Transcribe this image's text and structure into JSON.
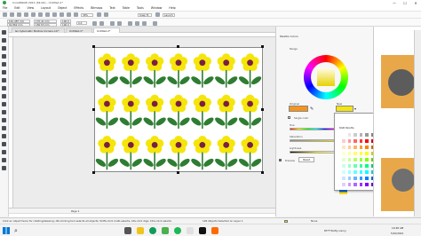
{
  "window": {
    "title": "CorelDRAW 2021 (64-bit) - Untitled-1*",
    "min": "—",
    "max": "☐",
    "close": "✕"
  },
  "menu": [
    "File",
    "Edit",
    "View",
    "Layout",
    "Object",
    "Effects",
    "Bitmaps",
    "Text",
    "Table",
    "Tools",
    "Window",
    "Help"
  ],
  "toolbar": {
    "zoom": "39%",
    "snap_to": "Snap To",
    "launch": "Launch",
    "x_value": "161.487 mm",
    "y_value": "91.862 mm",
    "w_value": "170.41 mm",
    "h_value": "156.53 mm",
    "scale_w": "100.0",
    "scale_h": "100.0",
    "angle": "0.0"
  },
  "tabs": [
    {
      "label": "Go Cybernetic Studios Corners.cdr*"
    },
    {
      "label": "Untitled-1*"
    },
    {
      "label": "Untitled-2*"
    }
  ],
  "page_nav": {
    "label": "Page 1"
  },
  "docker": {
    "title": "Palette Colors",
    "range_label": "Range",
    "original_label": "Original",
    "new_label": "New",
    "single_color_label": "Single color",
    "hue_label": "Hue",
    "saturation_label": "Saturation",
    "lightness_label": "Lightness",
    "preview_label": "Preview",
    "reset_label": "Reset",
    "original_color": "#f7941d",
    "new_color": "#f5e50a"
  },
  "palette_popup": {
    "title": "RGB Palette",
    "colors": [
      "#ffffff",
      "#e6e6e6",
      "#cccccc",
      "#b3b3b3",
      "#999999",
      "#808080",
      "#666666",
      "#4d4d4d",
      "#000000",
      "#ffcccc",
      "#ff9999",
      "#ff6666",
      "#ff3333",
      "#ff0000",
      "#cc0000",
      "#990000",
      "#660000",
      "#330000",
      "#ffe5cc",
      "#ffcc99",
      "#ffb266",
      "#ff9933",
      "#ff8000",
      "#cc6600",
      "#994c00",
      "#663300",
      "#331a00",
      "#ffffcc",
      "#ffff99",
      "#ffff66",
      "#ffff33",
      "#ffff00",
      "#cccc00",
      "#999900",
      "#666600",
      "#333300",
      "#e5ffcc",
      "#ccff99",
      "#b2ff66",
      "#99ff33",
      "#80ff00",
      "#66cc00",
      "#4c9900",
      "#336600",
      "#1a3300",
      "#ccffe5",
      "#99ffcc",
      "#66ffb2",
      "#33ff99",
      "#00ff80",
      "#00cc66",
      "#00994c",
      "#006633",
      "#00331a",
      "#ccffff",
      "#99ffff",
      "#66ffff",
      "#33ffff",
      "#00ffff",
      "#00cccc",
      "#009999",
      "#006666",
      "#003333",
      "#cce5ff",
      "#99ccff",
      "#66b2ff",
      "#3399ff",
      "#0080ff",
      "#0066cc",
      "#004c99",
      "#003366",
      "#001a33",
      "#e5ccff",
      "#cc99ff",
      "#b266ff",
      "#9933ff",
      "#8000ff",
      "#6600cc",
      "#4c0099",
      "#330066",
      "#1a0033"
    ]
  },
  "status": {
    "hint": "Click an object twice for rotating/skewing; dbl-clicking tool selects all objects; Shift+click multi-selects; Alt+click digs; Ctrl+click selects in a group",
    "selection": "126 Objects Selected on Layer 1",
    "color_label": "None"
  },
  "taskbar": {
    "weather": "83°F  Partly sunny",
    "time": "10:48 AM",
    "date": "5/10/2021"
  },
  "flowers": {
    "rows": 3,
    "cols": 7,
    "petal_color": "#f5e50a",
    "center_color": "#7a1f45",
    "leaf_color": "#2e7d32",
    "stem_color": "#2e7d32"
  }
}
